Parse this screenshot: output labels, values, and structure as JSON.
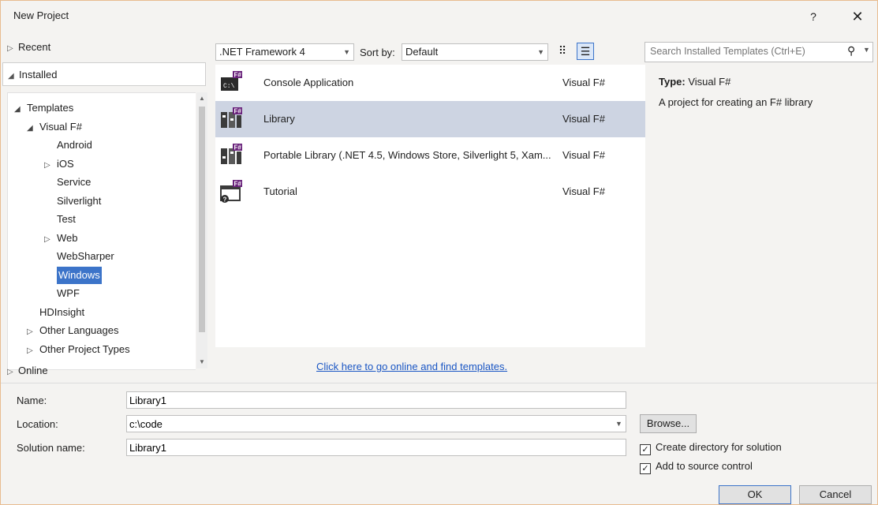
{
  "window": {
    "title": "New Project",
    "help": "?",
    "close": "✕"
  },
  "left": {
    "recent": "Recent",
    "installed": "Installed",
    "online": "Online",
    "tree": [
      {
        "label": "Templates",
        "glyph": "◢",
        "level": 0
      },
      {
        "label": "Visual F#",
        "glyph": "◢",
        "level": 1
      },
      {
        "label": "Android",
        "glyph": "",
        "level": 2
      },
      {
        "label": "iOS",
        "glyph": "▷",
        "level": 2
      },
      {
        "label": "Service",
        "glyph": "",
        "level": 2
      },
      {
        "label": "Silverlight",
        "glyph": "",
        "level": 2
      },
      {
        "label": "Test",
        "glyph": "",
        "level": 2
      },
      {
        "label": "Web",
        "glyph": "▷",
        "level": 2
      },
      {
        "label": "WebSharper",
        "glyph": "",
        "level": 2
      },
      {
        "label": "Windows",
        "glyph": "",
        "level": 2,
        "selected": true
      },
      {
        "label": "WPF",
        "glyph": "",
        "level": 2
      },
      {
        "label": "HDInsight",
        "glyph": "",
        "level": 1
      },
      {
        "label": "Other Languages",
        "glyph": "▷",
        "level": 1
      },
      {
        "label": "Other Project Types",
        "glyph": "▷",
        "level": 1
      }
    ]
  },
  "toolbar": {
    "framework": ".NET Framework 4",
    "sort_label": "Sort by:",
    "sort_value": "Default"
  },
  "templates": [
    {
      "name": "Console Application",
      "lang": "Visual F#",
      "icon": "console-app-icon"
    },
    {
      "name": "Library",
      "lang": "Visual F#",
      "icon": "library-icon",
      "selected": true
    },
    {
      "name": "Portable Library (.NET 4.5, Windows Store, Silverlight 5, Xam...",
      "lang": "Visual F#",
      "icon": "portable-library-icon"
    },
    {
      "name": "Tutorial",
      "lang": "Visual F#",
      "icon": "tutorial-icon"
    }
  ],
  "online_link": "Click here to go online and find templates.",
  "search": {
    "placeholder": "Search Installed Templates (Ctrl+E)"
  },
  "details": {
    "type_label": "Type:",
    "type_value": "Visual F#",
    "description": "A project for creating an F# library"
  },
  "form": {
    "name_label": "Name:",
    "name_value": "Library1",
    "location_label": "Location:",
    "location_value": "c:\\code",
    "solution_label": "Solution name:",
    "solution_value": "Library1",
    "browse": "Browse...",
    "create_dir": "Create directory for solution",
    "source_control": "Add to source control",
    "ok": "OK",
    "cancel": "Cancel"
  },
  "colors": {
    "accent": "#3c74c9",
    "selected_row": "#cdd4e2",
    "fsharp_badge": "#68217a",
    "link": "#1a56c4"
  }
}
